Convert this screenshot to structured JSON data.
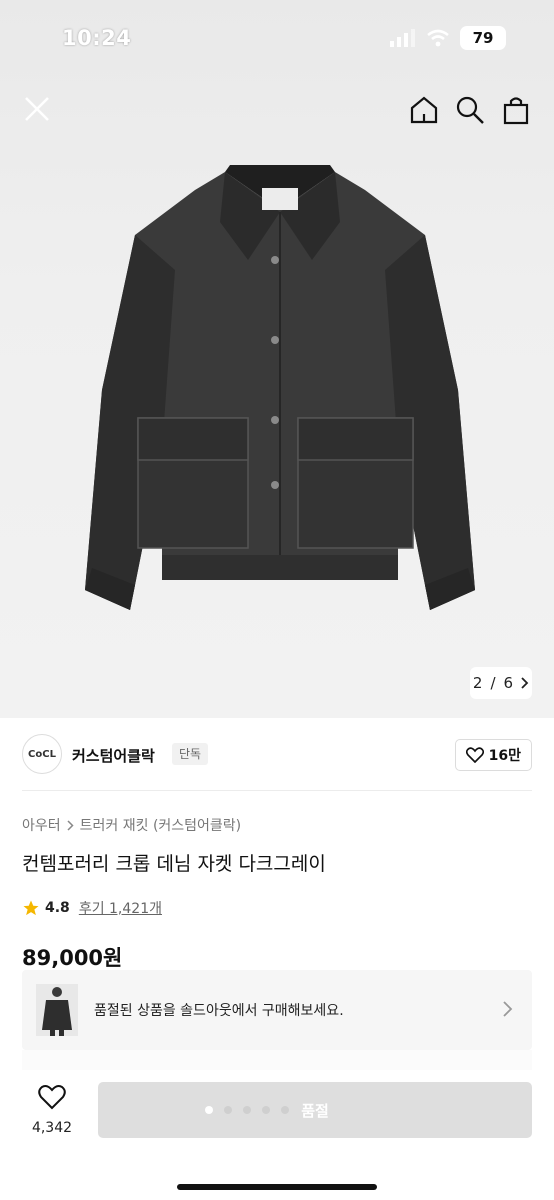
{
  "status_bar": {
    "time": "10:24",
    "battery": "79"
  },
  "nav": {
    "close_icon": "close-icon",
    "home_icon": "home-icon",
    "search_icon": "search-icon",
    "bag_icon": "shopping-bag-icon"
  },
  "gallery": {
    "current": "2",
    "separator": "/",
    "total": "6"
  },
  "brand": {
    "logo_text": "CoCL",
    "name": "커스텀어클락",
    "badge": "단독",
    "likes": "16만"
  },
  "breadcrumb": {
    "category": "아우터",
    "subcategory": "트러커 재킷 (커스텀어클락)"
  },
  "product": {
    "title": "컨템포러리 크롭 데님 자켓 다크그레이",
    "rating": "4.8",
    "reviews": "후기 1,421개",
    "price": "89,000원"
  },
  "banner": {
    "text": "품절된 상품을 솔드아웃에서 구매해보세요."
  },
  "bottom": {
    "wish_count": "4,342",
    "button_label": "품절"
  },
  "colors": {
    "accent_star": "#f5b700",
    "soldout_button": "#dedede"
  }
}
